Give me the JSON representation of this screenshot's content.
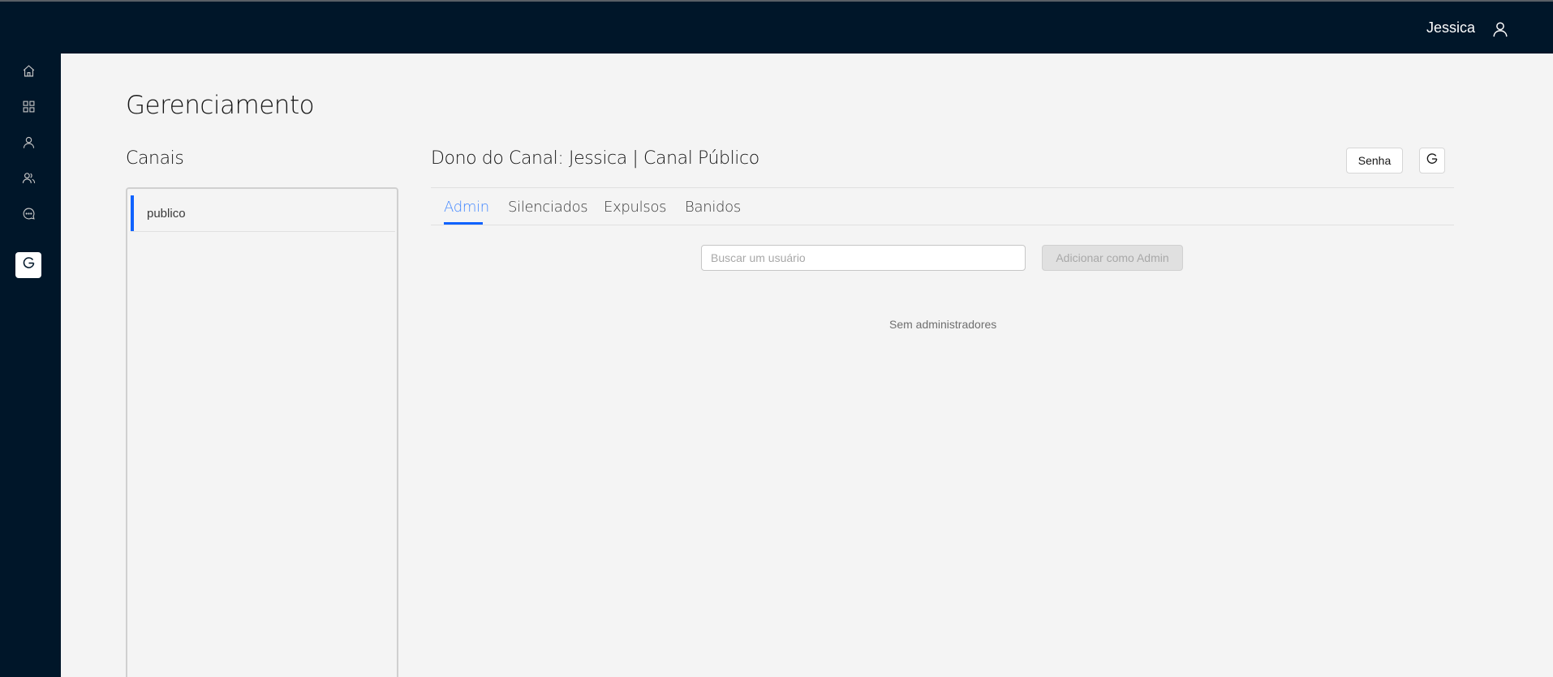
{
  "header": {
    "user_name": "Jessica",
    "user_icon": "user-icon"
  },
  "sidebar": {
    "items": [
      {
        "icon": "home-icon"
      },
      {
        "icon": "grid-icon"
      },
      {
        "icon": "user-icon"
      },
      {
        "icon": "users-icon"
      },
      {
        "icon": "chat-icon"
      },
      {
        "icon": "logo-icon",
        "active": true
      }
    ]
  },
  "page": {
    "title": "Gerenciamento"
  },
  "channels": {
    "title": "Canais",
    "items": [
      {
        "label": "publico",
        "selected": true
      }
    ]
  },
  "detail": {
    "title": "Dono do Canal: Jessica | Canal Público",
    "password_button": "Senha",
    "refresh_icon": "refresh-icon",
    "tabs": [
      {
        "label": "Admin",
        "active": true
      },
      {
        "label": "Silenciados"
      },
      {
        "label": "Expulsos"
      },
      {
        "label": "Banidos"
      }
    ],
    "search": {
      "placeholder": "Buscar um usuário",
      "value": ""
    },
    "add_button": "Adicionar como Admin",
    "empty_message": "Sem administradores"
  },
  "colors": {
    "navy": "#001629",
    "accent": "#0f62fe",
    "tab_active": "#4589ff",
    "background": "#f4f4f4"
  }
}
